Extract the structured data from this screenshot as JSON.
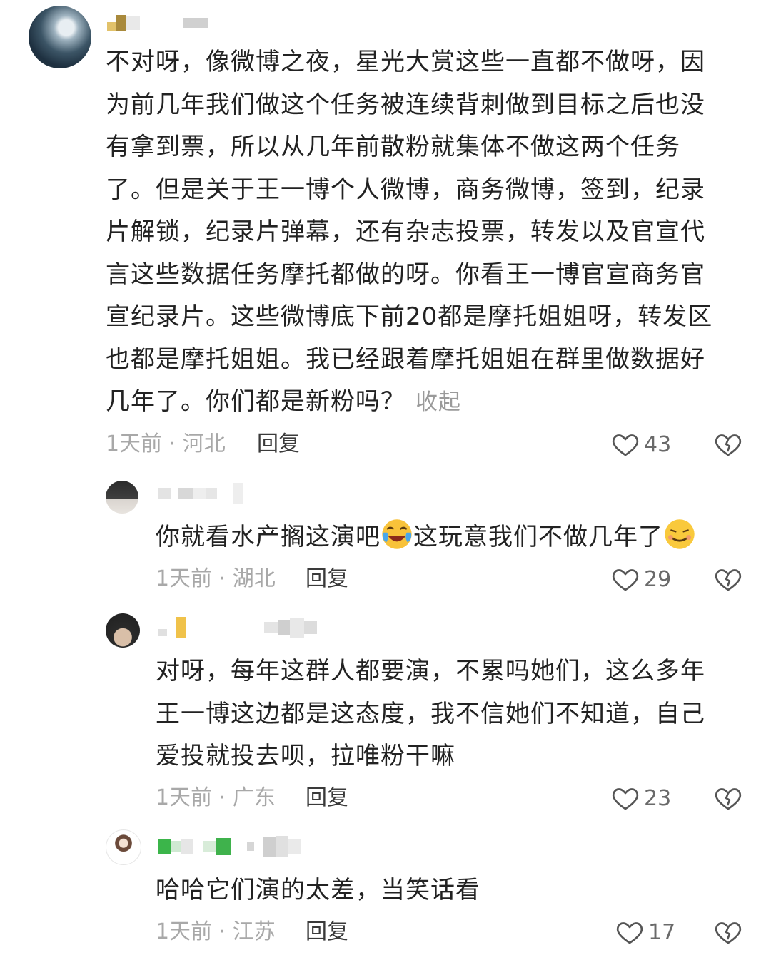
{
  "comments": [
    {
      "lines": [
        "不对呀，像微博之夜，星光大赏这些一直都不做呀，因",
        "为前几年我们做这个任务被连续背刺做到目标之后也没",
        "有拿到票，所以从几年前散粉就集体不做这两个任务",
        "了。但是关于王一博个人微博，商务微博，签到，纪录",
        "片解锁，纪录片弹幕，还有杂志投票，转发以及官宣代",
        "言这些数据任务摩托都做的呀。你看王一博官宣商务官",
        "宣纪录片。这些微博底下前20都是摩托姐姐呀，转发区",
        "也都是摩托姐姐。我已经跟着摩托姐姐在群里做数据好",
        "几年了。你们都是新粉吗？"
      ],
      "collapse": "收起",
      "time": "1天前",
      "location": "河北",
      "reply": "回复",
      "likes": "43"
    },
    {
      "text_before": "你就看水产搁这演吧",
      "text_middle": "这玩意我们不做几年了",
      "time": "1天前",
      "location": "湖北",
      "reply": "回复",
      "likes": "29"
    },
    {
      "lines": [
        "对呀，每年这群人都要演，不累吗她们，这么多年",
        "王一博这边都是这态度，我不信她们不知道，自己",
        "爱投就投去呗，拉唯粉干嘛"
      ],
      "time": "1天前",
      "location": "广东",
      "reply": "回复",
      "likes": "23"
    },
    {
      "text": "哈哈它们演的太差，当笑话看",
      "time": "1天前",
      "location": "江苏",
      "reply": "回复",
      "likes": "17"
    }
  ],
  "meta_separator": " · ",
  "icons": {
    "like": "heart-outline-icon",
    "dislike": "broken-heart-icon",
    "emoji_1": "crying-laughing-emoji",
    "emoji_2": "smug-grin-emoji"
  }
}
